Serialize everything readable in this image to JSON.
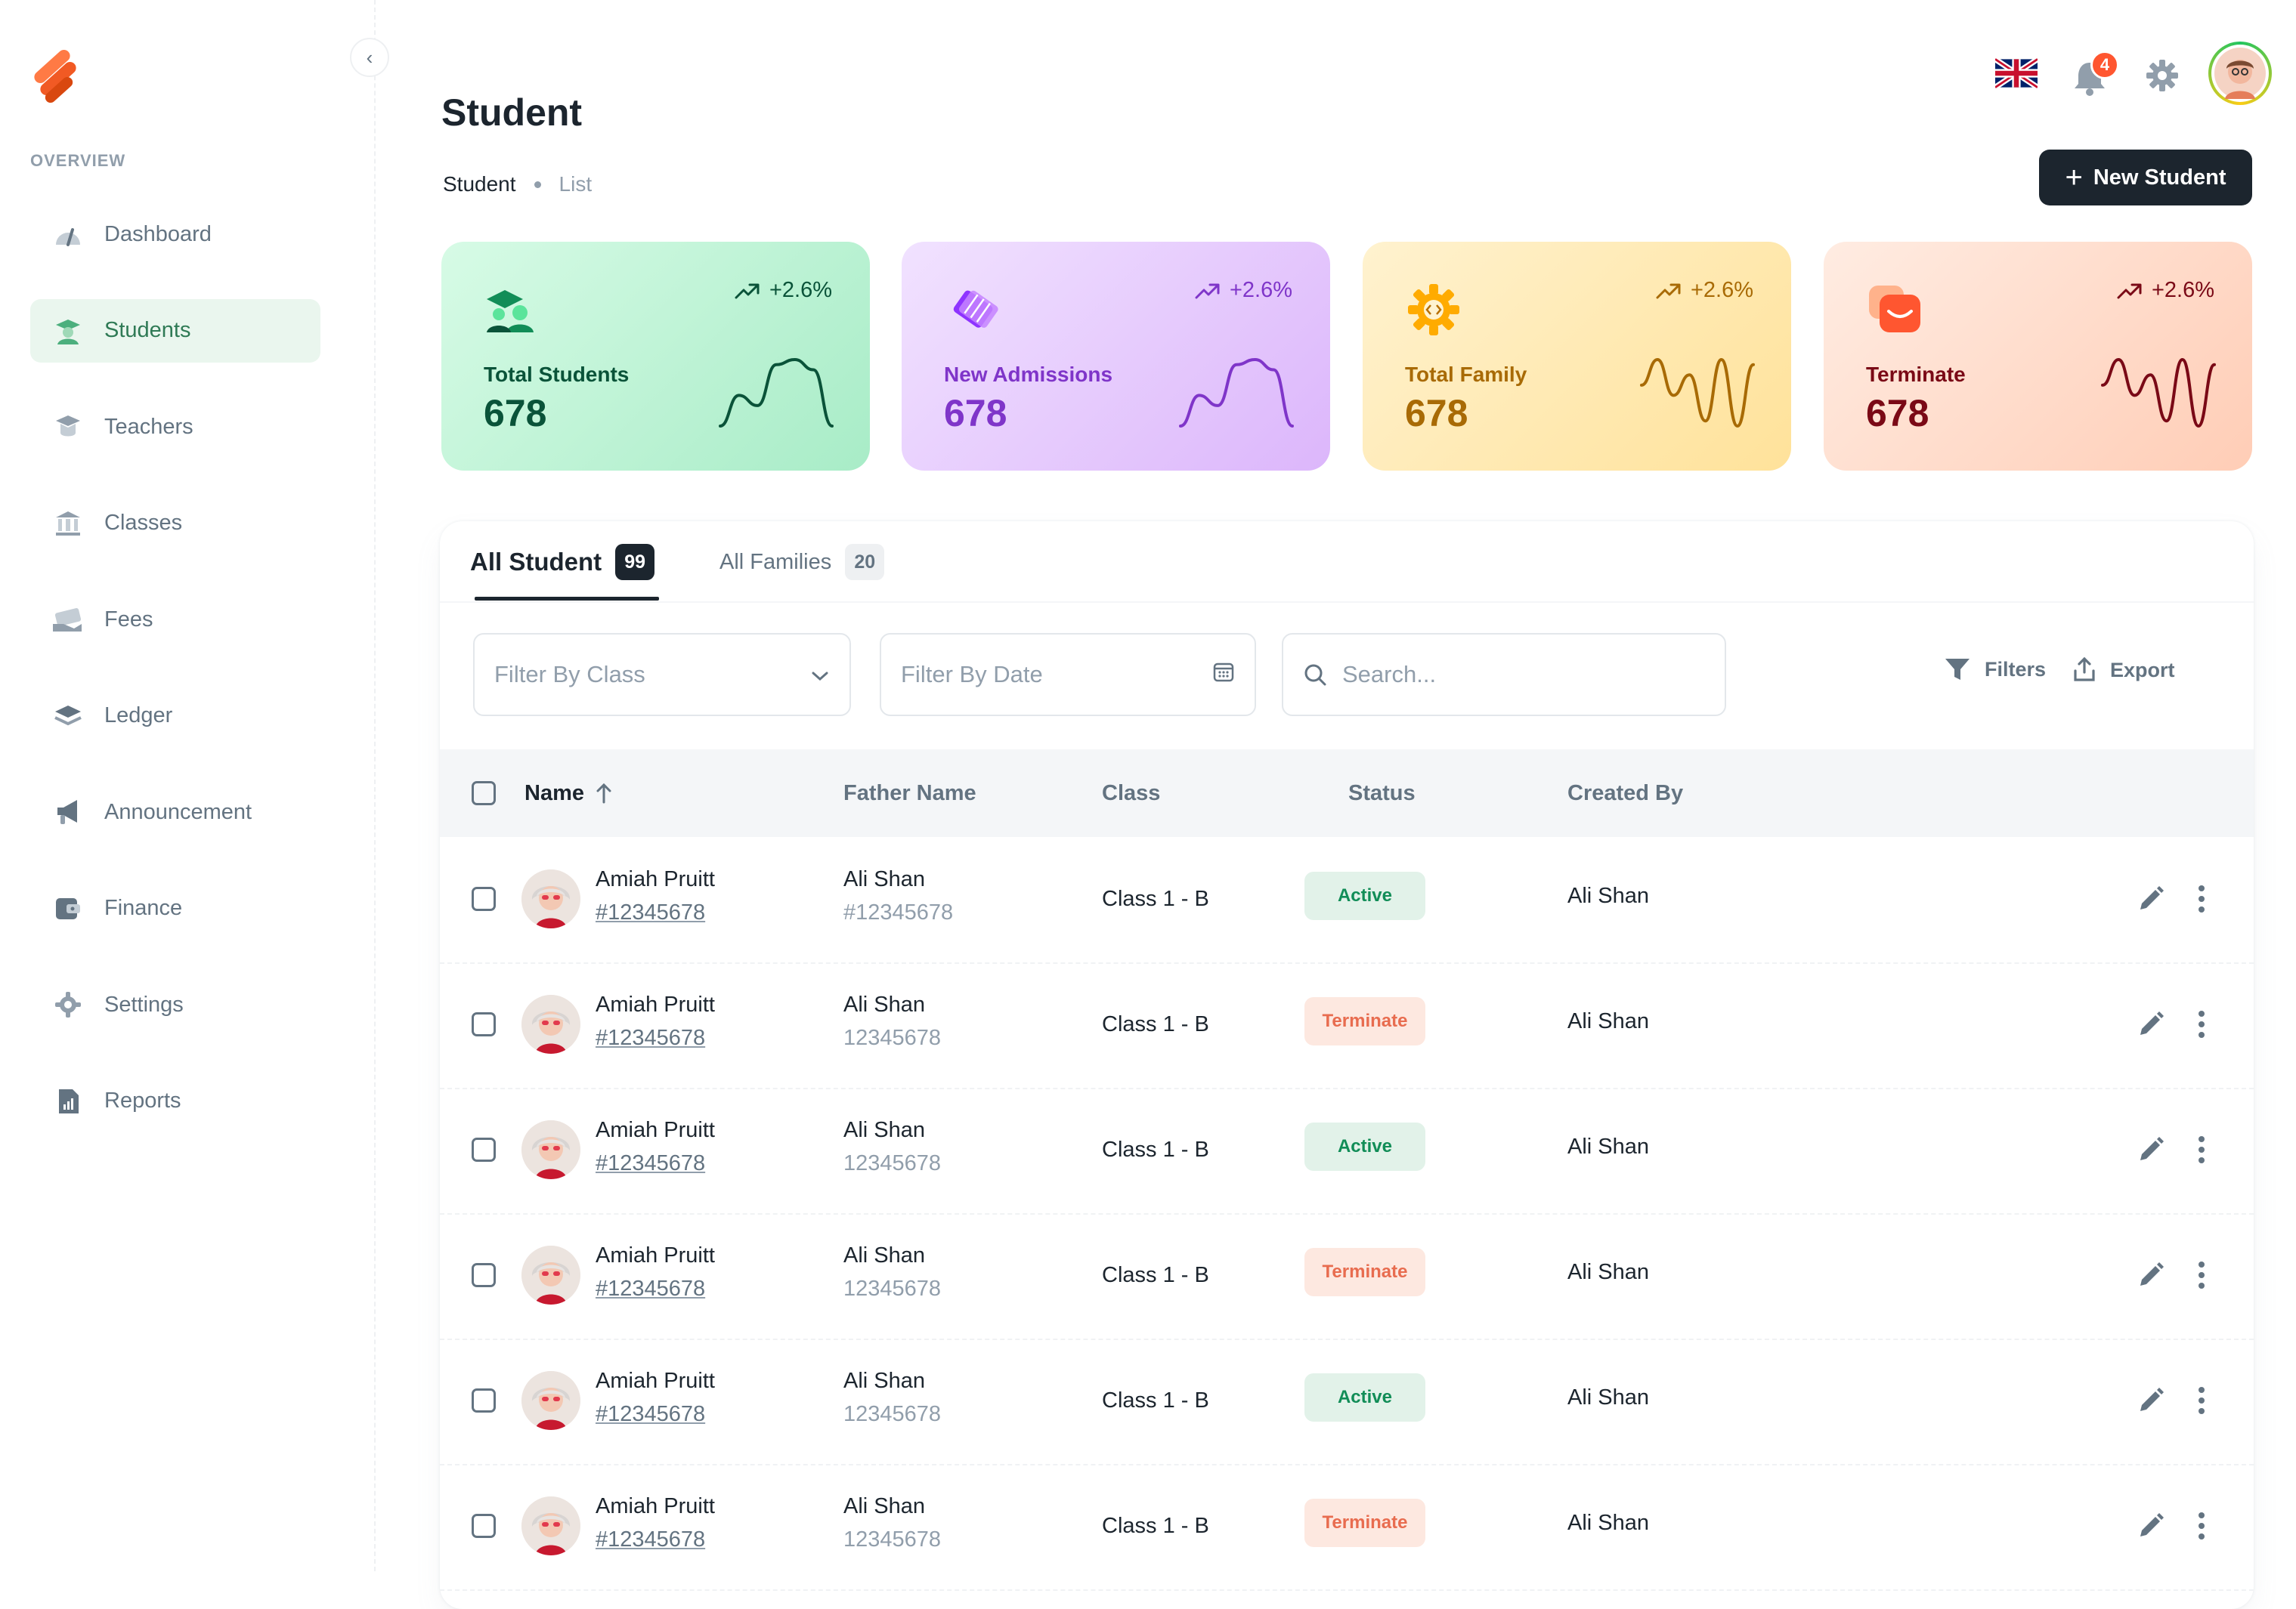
{
  "sidebar": {
    "section_label": "OVERVIEW",
    "items": [
      {
        "label": "Dashboard",
        "icon": "dashboard-icon",
        "active": false
      },
      {
        "label": "Students",
        "icon": "students-icon",
        "active": true
      },
      {
        "label": "Teachers",
        "icon": "teachers-icon",
        "active": false
      },
      {
        "label": "Classes",
        "icon": "classes-icon",
        "active": false
      },
      {
        "label": "Fees",
        "icon": "fees-icon",
        "active": false
      },
      {
        "label": "Ledger",
        "icon": "ledger-icon",
        "active": false
      },
      {
        "label": "Announcement",
        "icon": "announcement-icon",
        "active": false
      },
      {
        "label": "Finance",
        "icon": "finance-icon",
        "active": false
      },
      {
        "label": "Settings",
        "icon": "settings-icon",
        "active": false
      },
      {
        "label": "Reports",
        "icon": "reports-icon",
        "active": false
      }
    ]
  },
  "header": {
    "notification_count": "4",
    "language_icon": "uk-flag-icon"
  },
  "page": {
    "title": "Student",
    "breadcrumb": [
      "Student",
      "List"
    ],
    "new_button_label": "New Student"
  },
  "cards": [
    {
      "label": "Total Students",
      "value": "678",
      "trend": "+2.6%",
      "icon": "graduation-icon",
      "gradient": [
        "#d7fbe6",
        "#a8ecc7"
      ],
      "text_color": "#0a5339",
      "sparkline": [
        2,
        8,
        6,
        14,
        15,
        13,
        2
      ]
    },
    {
      "label": "New Admissions",
      "value": "678",
      "trend": "+2.6%",
      "icon": "ticket-icon",
      "gradient": [
        "#f1e2ff",
        "#dcb6fb"
      ],
      "text_color": "#7f35c9",
      "sparkline": [
        2,
        8,
        6,
        14,
        15,
        13,
        2
      ]
    },
    {
      "label": "Total Family",
      "value": "678",
      "trend": "+2.6%",
      "icon": "gear-badge-icon",
      "gradient": [
        "#fff2cf",
        "#ffe29a"
      ],
      "text_color": "#a86a05",
      "sparkline": [
        10,
        15,
        8,
        12,
        3,
        15,
        2,
        14
      ]
    },
    {
      "label": "Terminate",
      "value": "678",
      "trend": "+2.6%",
      "icon": "message-icon",
      "gradient": [
        "#ffece2",
        "#ffcdb6"
      ],
      "text_color": "#7a0916",
      "sparkline": [
        10,
        15,
        8,
        12,
        3,
        15,
        2,
        14
      ]
    }
  ],
  "tabs": [
    {
      "label": "All Student",
      "count": "99",
      "active": true
    },
    {
      "label": "All Families",
      "count": "20",
      "active": false
    }
  ],
  "filters": {
    "class_placeholder": "Filter By Class",
    "date_placeholder": "Filter By Date",
    "search_placeholder": "Search...",
    "filters_label": "Filters",
    "export_label": "Export"
  },
  "table": {
    "columns": [
      "Name",
      "Father Name",
      "Class",
      "Status",
      "Created By"
    ],
    "rows": [
      {
        "name": "Amiah Pruitt",
        "id": "#12345678",
        "father": "Ali Shan",
        "father_id": "#12345678",
        "class": "Class 1 - B",
        "status": "Active",
        "created_by": "Ali Shan"
      },
      {
        "name": "Amiah Pruitt",
        "id": "#12345678",
        "father": "Ali Shan",
        "father_id": "12345678",
        "class": "Class 1 - B",
        "status": "Terminate",
        "created_by": "Ali Shan"
      },
      {
        "name": "Amiah Pruitt",
        "id": "#12345678",
        "father": "Ali Shan",
        "father_id": "12345678",
        "class": "Class 1 - B",
        "status": "Active",
        "created_by": "Ali Shan"
      },
      {
        "name": "Amiah Pruitt",
        "id": "#12345678",
        "father": "Ali Shan",
        "father_id": "12345678",
        "class": "Class 1 - B",
        "status": "Terminate",
        "created_by": "Ali Shan"
      },
      {
        "name": "Amiah Pruitt",
        "id": "#12345678",
        "father": "Ali Shan",
        "father_id": "12345678",
        "class": "Class 1 - B",
        "status": "Active",
        "created_by": "Ali Shan"
      },
      {
        "name": "Amiah Pruitt",
        "id": "#12345678",
        "father": "Ali Shan",
        "father_id": "12345678",
        "class": "Class 1 - B",
        "status": "Terminate",
        "created_by": "Ali Shan"
      }
    ]
  },
  "colors": {
    "primary_dark": "#1c252e",
    "active_green": "#118d57",
    "terminate_orange": "#e86c4f",
    "brand_orange": "#f15a24",
    "notification_red": "#ff5630"
  }
}
